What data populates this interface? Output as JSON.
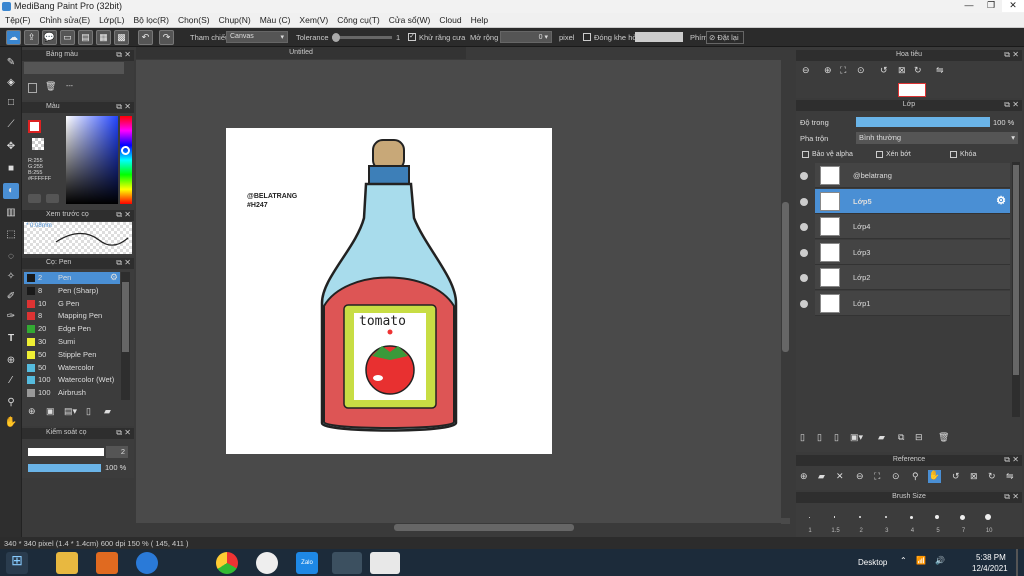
{
  "window": {
    "title": "MediBang Paint Pro (32bit)"
  },
  "menu": [
    "Tệp(F)",
    "Chỉnh sửa(E)",
    "Lớp(L)",
    "Bộ lọc(R)",
    "Chọn(S)",
    "Chụp(N)",
    "Màu (C)",
    "Xem(V)",
    "Công cụ(T)",
    "Cửa sổ(W)",
    "Cloud",
    "Help"
  ],
  "toolbar": {
    "ref_label": "Tham chiếu",
    "ref_value": "Canvas",
    "tolerance_label": "Tolerance",
    "tolerance_value": "1",
    "antialias_label": "Khử răng cưa",
    "expand_label": "Mở rộng",
    "expand_value": "0",
    "pixel_label": "pixel",
    "close_gap_label": "Đóng khe hở",
    "key_label": "Phím",
    "reset_label": "Đặt lại"
  },
  "doc": {
    "title": "Untitled"
  },
  "panels": {
    "palette": "Bảng màu",
    "palette_value": "---",
    "color": "Màu",
    "color_r": "R:255",
    "color_g": "G:255",
    "color_b": "B:255",
    "color_hex": "#FFFFFF",
    "brush_preview": "Xem trước cọ",
    "brush_preview_size": "0.08mm",
    "brush": "Cọ: Pen",
    "brush_control": "Kiểm soát cọ",
    "brush_size_value": "2",
    "brush_opacity_value": "100 %"
  },
  "brushes": [
    {
      "size": "2",
      "name": "Pen",
      "color": "#1a1a1a",
      "selected": true
    },
    {
      "size": "8",
      "name": "Pen (Sharp)",
      "color": "#1a1a1a"
    },
    {
      "size": "10",
      "name": "G Pen",
      "color": "#d33"
    },
    {
      "size": "8",
      "name": "Mapping Pen",
      "color": "#d33"
    },
    {
      "size": "20",
      "name": "Edge Pen",
      "color": "#3a3"
    },
    {
      "size": "30",
      "name": "Sumi",
      "color": "#ee3"
    },
    {
      "size": "50",
      "name": "Stipple Pen",
      "color": "#ee3"
    },
    {
      "size": "50",
      "name": "Watercolor",
      "color": "#5bd"
    },
    {
      "size": "100",
      "name": "Watercolor (Wet)",
      "color": "#5bd"
    },
    {
      "size": "100",
      "name": "Airbrush",
      "color": "#999"
    }
  ],
  "navigator": {
    "title": "Hoa tiêu"
  },
  "layers_panel": {
    "title": "Lớp",
    "opacity_label": "Độ trong",
    "opacity_value": "100 %",
    "opacity_fraction": 1.0,
    "blend_label": "Pha trộn",
    "blend_value": "Bình thường",
    "protect_alpha": "Bảo vệ alpha",
    "clip": "Xén bớt",
    "lock": "Khóa"
  },
  "layers": [
    {
      "name": "@belatrang",
      "selected": false
    },
    {
      "name": "Lớp5",
      "selected": true
    },
    {
      "name": "Lớp4",
      "selected": false
    },
    {
      "name": "Lớp3",
      "selected": false
    },
    {
      "name": "Lớp2",
      "selected": false
    },
    {
      "name": "Lớp1",
      "selected": false
    }
  ],
  "reference": {
    "title": "Reference"
  },
  "brush_size": {
    "title": "Brush Size",
    "sizes": [
      "1",
      "1.5",
      "2",
      "3",
      "4",
      "5",
      "7",
      "10"
    ]
  },
  "artwork": {
    "signature": "@BELATRANG",
    "tag": "#H247",
    "label": "tomato"
  },
  "status": {
    "text": "340 * 340 pixel  (1.4 * 1.4cm)  600 dpi  150 %  ( 145, 411 )"
  },
  "taskbar": {
    "desktop": "Desktop",
    "time": "5:38 PM",
    "date": "12/4/2021",
    "zalo": "Zalo"
  },
  "colors": {
    "accent": "#4a90d0",
    "selected_layer": "#4a8fd4"
  }
}
